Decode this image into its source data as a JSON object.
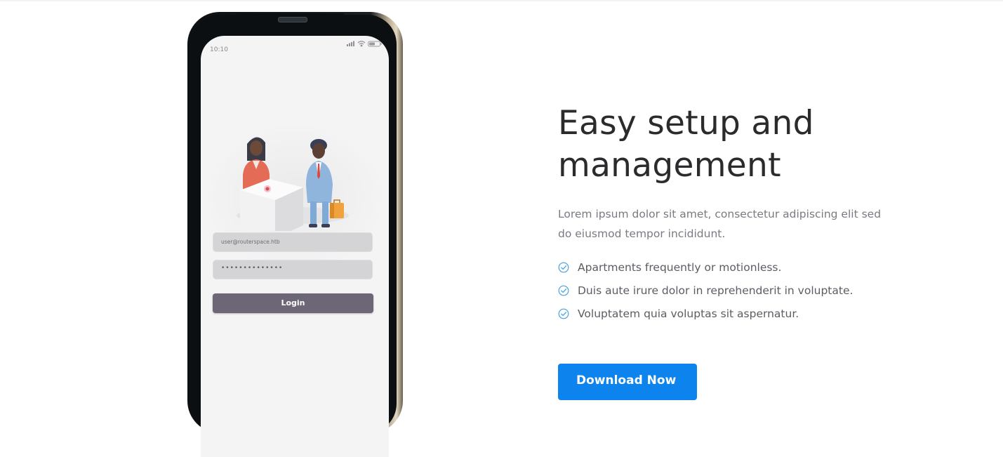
{
  "phone": {
    "time": "10:10",
    "email_value": "user@routerspace.htb",
    "password_value": "••••••••••••••",
    "login_label": "Login"
  },
  "section": {
    "title_line1": "Easy setup and",
    "title_line2": "management",
    "description_line1": "Lorem ipsum dolor sit amet, consectetur adipiscing elit sed",
    "description_line2": "do eiusmod tempor incididunt.",
    "features": [
      "Apartments frequently or motionless.",
      "Duis aute irure dolor in reprehenderit in voluptate.",
      "Voluptatem quia voluptas sit aspernatur."
    ],
    "cta_label": "Download Now"
  },
  "icons": {
    "feature": "check-circle-icon",
    "signal": "signal-icon",
    "wifi": "wifi-icon",
    "battery": "battery-icon"
  },
  "colors": {
    "accent": "#0d83ee",
    "check": "#4aa3e0",
    "login_button": "#6c6677"
  }
}
